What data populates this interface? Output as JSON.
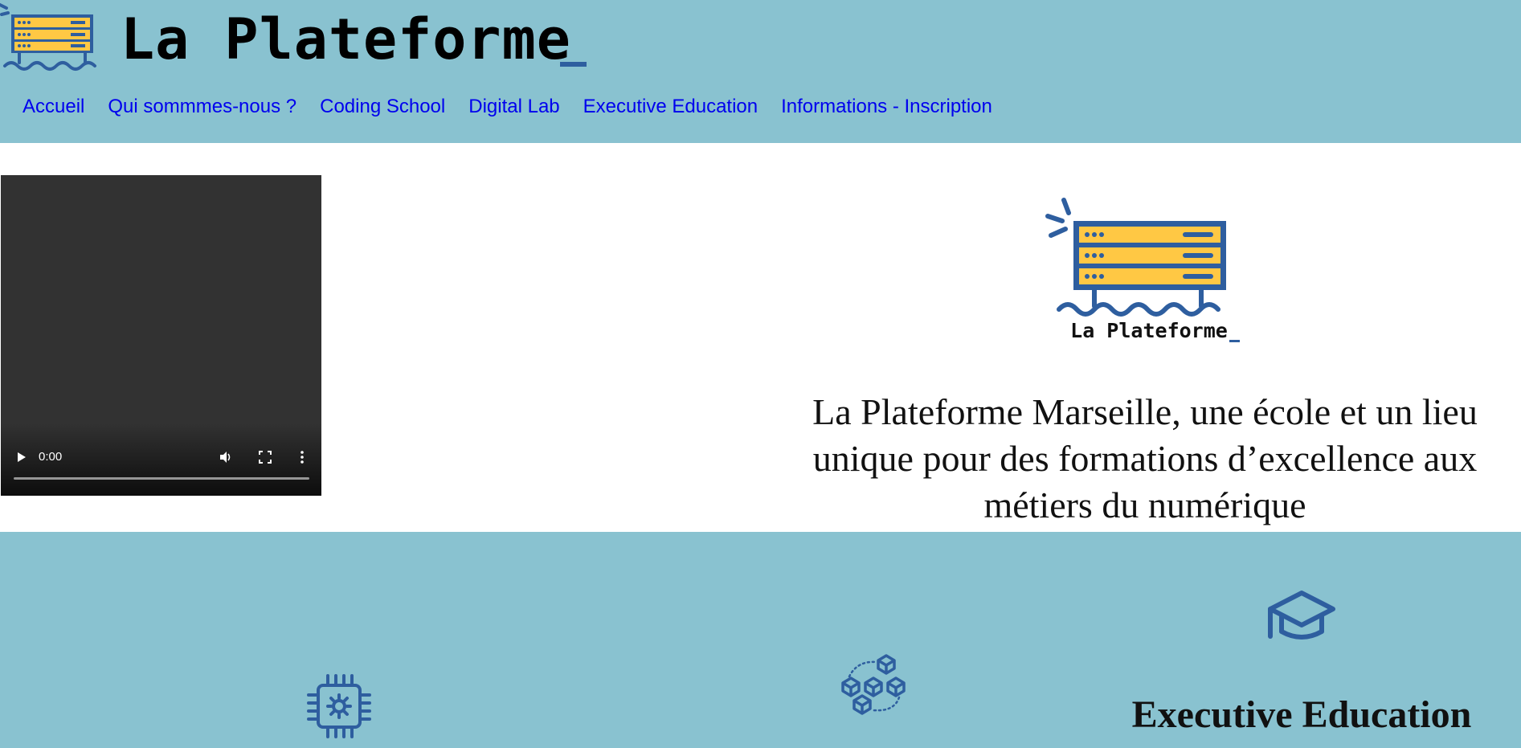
{
  "brand": {
    "name": "La Plateforme",
    "cursor": "_"
  },
  "nav": {
    "items": [
      "Accueil",
      "Qui sommmes-nous ?",
      "Coding School",
      "Digital Lab",
      "Executive Education",
      "Informations - Inscription"
    ]
  },
  "video": {
    "time": "0:00"
  },
  "hero": {
    "logo_text": "La Plateforme",
    "tagline": "La Plateforme Marseille, une école et un lieu unique pour des formations d’excellence aux métiers du numérique"
  },
  "programs": {
    "coding_school_icon": "chip-icon",
    "digital_lab_icon": "blocks-icon",
    "executive_icon": "graduation-cap-icon",
    "executive_title": "Executive Education"
  },
  "colors": {
    "header_bg": "#89c2d0",
    "brand_blue": "#2e5e9f",
    "server_yellow": "#ffc844",
    "link": "#0000ee"
  }
}
